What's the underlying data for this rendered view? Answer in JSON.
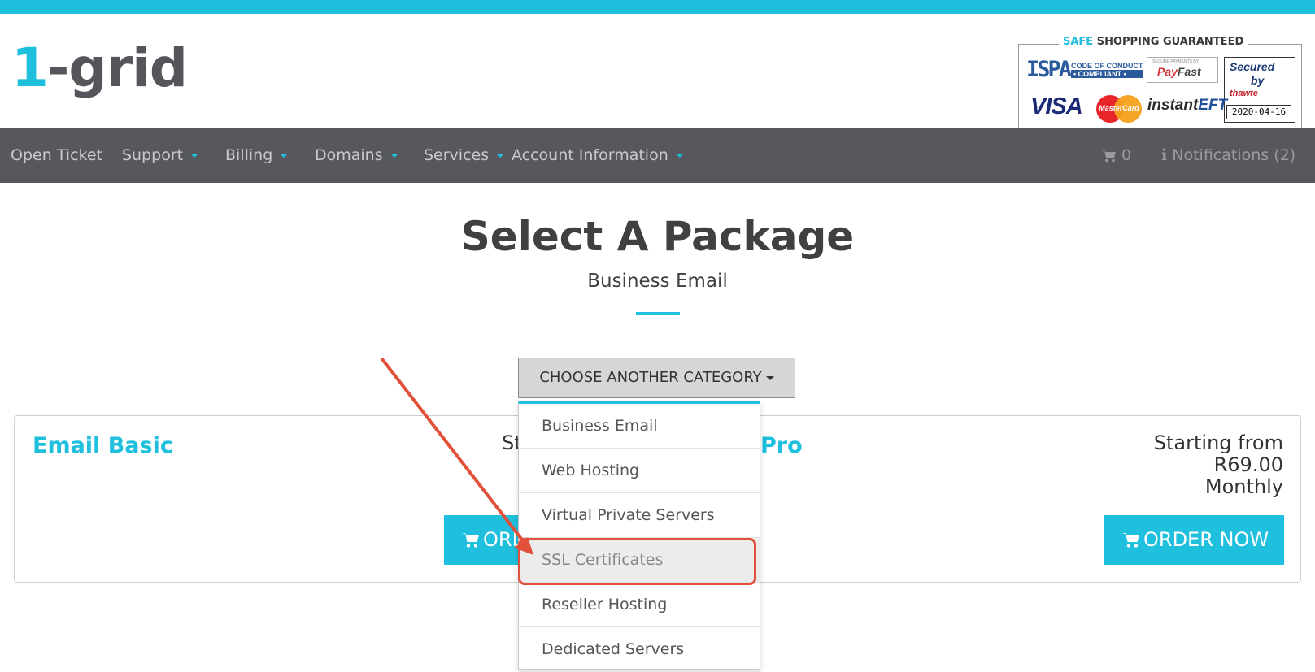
{
  "header": {
    "logo": {
      "part1": "1",
      "part2": "-grid"
    },
    "trust_seal": {
      "title_safe": "SAFE",
      "title_rest": " SHOPPING GUARANTEED",
      "ispa_big": "ISPA",
      "ispa_line1": "CODE OF CONDUCT",
      "ispa_line2": "• COMPLIANT •",
      "payfast_small": "SECURE PAYMENTS BY",
      "payfast_pay": "Pay",
      "payfast_fast": "Fast",
      "thawte_secured": "Secured",
      "thawte_by": "by",
      "thawte_name": "thawte",
      "thawte_date": "2020-04-16",
      "visa": "VISA",
      "mastercard": "MasterCard",
      "eft_instant": "instant",
      "eft_eft": "EFT"
    }
  },
  "nav": {
    "open_ticket": "Open Ticket",
    "support": "Support",
    "billing": "Billing",
    "domains": "Domains",
    "services": "Services",
    "account_information": "Account Information",
    "cart_count": "0",
    "notifications": "Notifications (2)"
  },
  "main": {
    "title": "Select A Package",
    "subtitle": "Business Email",
    "category_button": "CHOOSE ANOTHER CATEGORY",
    "packages": [
      {
        "name": "Email Basic",
        "price_line1": "St",
        "order_label": "ORDER NOW"
      },
      {
        "name": "Pro",
        "price_line1": "Starting from",
        "price_line2": "R69.00",
        "price_line3": "Monthly",
        "order_label": "ORDER NOW"
      }
    ],
    "dropdown_items": [
      "Business Email",
      "Web Hosting",
      "Virtual Private Servers",
      "SSL Certificates",
      "Reseller Hosting",
      "Dedicated Servers"
    ]
  },
  "colors": {
    "accent": "#1fbfde",
    "nav_bg": "#57585d",
    "annotation": "#e0503a"
  }
}
